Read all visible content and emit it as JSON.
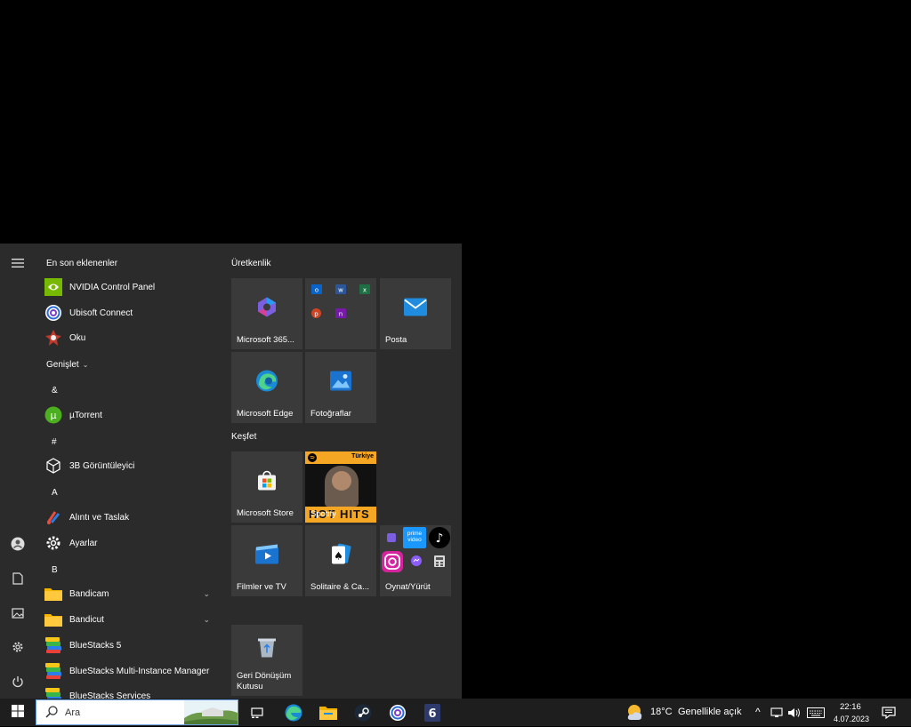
{
  "start_menu": {
    "list_header": "En son eklenenler",
    "recent": [
      {
        "label": "NVIDIA Control Panel",
        "icon": "nvidia-icon"
      },
      {
        "label": "Ubisoft Connect",
        "icon": "ubisoft-icon"
      },
      {
        "label": "Oku",
        "icon": "oku-icon"
      }
    ],
    "expand_label": "Genişlet",
    "letters": [
      "&",
      "#",
      "A",
      "B"
    ],
    "apps": [
      {
        "label": "µTorrent",
        "icon": "utorrent-icon"
      },
      {
        "label": "3B Görüntüleyici",
        "icon": "3d-viewer-icon"
      },
      {
        "label": "Alıntı ve Taslak",
        "icon": "snip-sketch-icon"
      },
      {
        "label": "Ayarlar",
        "icon": "gear-icon"
      },
      {
        "label": "Bandicam",
        "icon": "folder-icon"
      },
      {
        "label": "Bandicut",
        "icon": "folder-icon"
      },
      {
        "label": "BlueStacks 5",
        "icon": "bluestacks-icon"
      },
      {
        "label": "BlueStacks Multi-Instance Manager",
        "icon": "bluestacks-icon"
      },
      {
        "label": "BlueStacks Services",
        "icon": "bluestacks-icon"
      }
    ],
    "groups": {
      "productivity": "Üretkenlik",
      "explore": "Keşfet"
    },
    "tiles": {
      "m365": "Microsoft 365...",
      "mail": "Posta",
      "edge": "Microsoft Edge",
      "photos": "Fotoğraflar",
      "store": "Microsoft Store",
      "spotify": "Spotify",
      "spotify_badge": "Türkiye",
      "spotify_banner": "HOT HITS",
      "movies": "Filmler ve TV",
      "solitaire": "Solitaire & Ca...",
      "play": "Oynat/Yürüt",
      "recycle": "Geri Dönüşüm Kutusu",
      "prime_text": "prime video"
    }
  },
  "taskbar": {
    "search_placeholder": "Ara",
    "weather_temp": "18°C",
    "weather_text": "Genellikle açık",
    "time": "22:16",
    "date": "4.07.2023"
  },
  "colors": {
    "accent": "#0078d4",
    "nvidia": "#76b900",
    "folder": "#f4b400",
    "spotify_bg": "#f5a623"
  }
}
